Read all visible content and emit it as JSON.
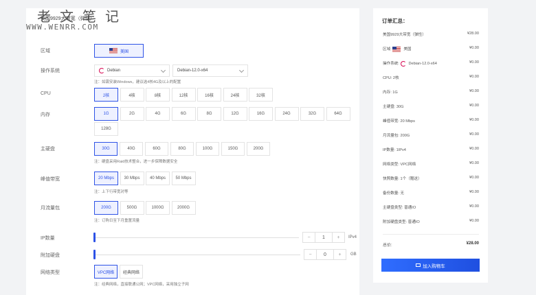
{
  "watermark": {
    "brand_cn": "老文笔记",
    "url": "WWW.WENRR.COM"
  },
  "product": {
    "title": "美国9929大带宽（弹性）"
  },
  "config": {
    "region": {
      "label": "区域",
      "value": "美国"
    },
    "os": {
      "label": "操作系统",
      "family": "Debian",
      "version": "Debian-12.0-x64",
      "note": "注：如需安装Windows，建议选4核4G及以上的配置"
    },
    "cpu": {
      "label": "CPU",
      "options": [
        "2核",
        "4核",
        "8核",
        "12核",
        "16核",
        "24核",
        "32核"
      ],
      "selected": 0
    },
    "memory": {
      "label": "内存",
      "options": [
        "1G",
        "2G",
        "4G",
        "6G",
        "8G",
        "12G",
        "16G",
        "24G",
        "32G",
        "64G",
        "128G"
      ],
      "selected": 0
    },
    "disk": {
      "label": "主硬盘",
      "options": [
        "30G",
        "40G",
        "60G",
        "80G",
        "100G",
        "150G",
        "200G"
      ],
      "selected": 0,
      "note": "注：硬盘采用Raid技术整合，进一步保障数据安全"
    },
    "bandwidth": {
      "label": "峰值带宽",
      "options": [
        "20 Mbps",
        "30 Mbps",
        "40 Mbps",
        "50 Mbps"
      ],
      "selected": 0,
      "note": "注：上下行带宽对等"
    },
    "traffic": {
      "label": "月流量包",
      "options": [
        "200G",
        "500G",
        "1000G",
        "2000G"
      ],
      "selected": 0,
      "note": "注：订购日至下月重置流量"
    },
    "ip": {
      "label": "IP数量",
      "minus": "−",
      "value": "1",
      "plus": "+",
      "unit": "IPv4"
    },
    "extra_disk": {
      "label": "附加硬盘",
      "minus": "−",
      "value": "0",
      "plus": "+",
      "unit": "GB"
    },
    "network": {
      "label": "网络类型",
      "options": [
        "VPC网络",
        "经典网络"
      ],
      "selected": 0,
      "note": "注：经典网络，直接联通公网；VPC网络，采用独立子网"
    }
  },
  "summary": {
    "title": "订单汇总：",
    "rows": [
      {
        "label": "美国9929大带宽（弹性）",
        "price": "¥28.00"
      },
      {
        "label": "区域",
        "value": "美国",
        "price": "¥0.00"
      },
      {
        "label": "操作系统",
        "value": "Debian-12.0-x64",
        "price": "¥0.00"
      },
      {
        "label": "CPU: 2核",
        "price": "¥0.00"
      },
      {
        "label": "内存: 1G",
        "price": "¥0.00"
      },
      {
        "label": "主硬盘: 30G",
        "price": "¥0.00"
      },
      {
        "label": "峰值带宽: 20 Mbps",
        "price": "¥0.00"
      },
      {
        "label": "月流量包: 200G",
        "price": "¥0.00"
      },
      {
        "label": "IP数量: 1IPv4",
        "price": "¥0.00"
      },
      {
        "label": "网络类型: VPC网络",
        "price": "¥0.00"
      },
      {
        "label": "快照数量: 1个（赠送）",
        "price": "¥0.00"
      },
      {
        "label": "备份数量: 无",
        "price": "¥0.00"
      },
      {
        "label": "主硬盘类型: 普通IO",
        "price": "¥0.00"
      },
      {
        "label": "附加硬盘类型: 普通IO",
        "price": "¥0.00"
      }
    ],
    "total_label": "总价:",
    "total": "¥28.00",
    "cart_button": "加入购物车"
  },
  "colors": {
    "accent": "#2d52e6",
    "button": "#2f6dff",
    "background": "#f2f3f5"
  }
}
